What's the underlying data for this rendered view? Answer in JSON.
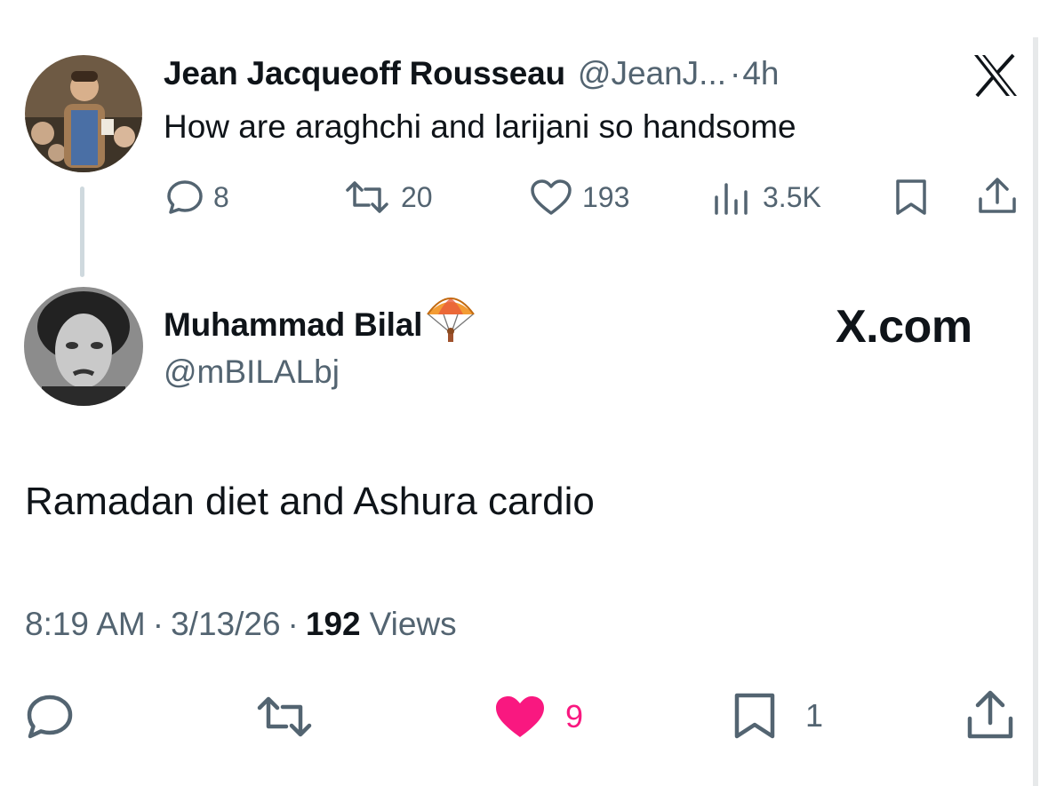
{
  "quoted_tweet": {
    "author_name": "Jean Jacqueoff Rousseau",
    "handle": "@JeanJ...",
    "separator": "·",
    "time": "4h",
    "text": "How are araghchi and larijani so handsome",
    "actions": {
      "replies": "8",
      "retweets": "20",
      "likes": "193",
      "views": "3.5K"
    },
    "icons": [
      "x-logo-icon",
      "reply-icon",
      "retweet-icon",
      "like-icon",
      "views-icon",
      "bookmark-icon",
      "share-icon"
    ]
  },
  "main_tweet": {
    "author_name": "Muhammad Bilal",
    "name_emoji": "parachute",
    "handle": "@mBILALbj",
    "watermark": "X.com",
    "text": "Ramadan diet and Ashura cardio",
    "meta": {
      "time": "8:19 AM",
      "sep1": "·",
      "date": "3/13/26",
      "sep2": "·",
      "views_count": "192",
      "views_label": "Views"
    },
    "actions": {
      "likes": "9",
      "bookmarks": "1"
    },
    "like_color": "#f91880"
  }
}
